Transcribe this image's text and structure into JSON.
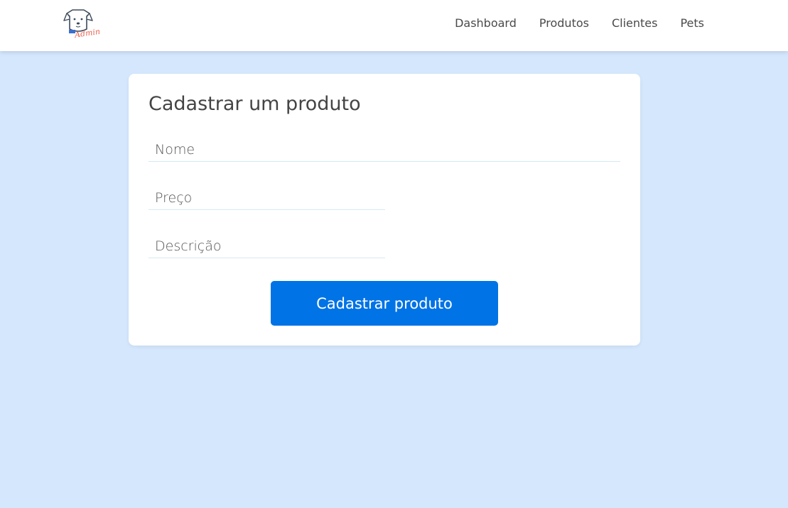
{
  "header": {
    "logo": {
      "icon": "dog-admin-logo-icon",
      "wordmark": "Admin"
    },
    "nav": [
      {
        "label": "Dashboard"
      },
      {
        "label": "Produtos"
      },
      {
        "label": "Clientes"
      },
      {
        "label": "Pets"
      }
    ]
  },
  "form": {
    "title": "Cadastrar um produto",
    "fields": {
      "name": {
        "placeholder": "Nome",
        "value": ""
      },
      "price": {
        "placeholder": "Preço",
        "value": ""
      },
      "description": {
        "placeholder": "Descrição",
        "value": ""
      }
    },
    "submit_label": "Cadastrar produto"
  },
  "colors": {
    "background": "#d4e7fd",
    "primary_button": "#0073e6",
    "logo_accent": "#e8604c",
    "logo_outline": "#3b4a5a"
  }
}
